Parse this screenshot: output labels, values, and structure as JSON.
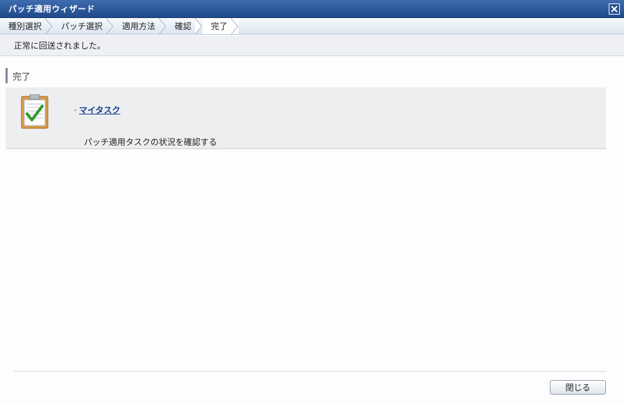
{
  "window": {
    "title": "パッチ適用ウィザード"
  },
  "steps": [
    {
      "label": "種別選択"
    },
    {
      "label": "パッチ選択"
    },
    {
      "label": "適用方法"
    },
    {
      "label": "確認"
    },
    {
      "label": "完了"
    }
  ],
  "message": "正常に回送されました。",
  "section": {
    "title": "完了"
  },
  "task": {
    "bullet": "･",
    "link_label": "マイタスク",
    "description": "パッチ適用タスクの状況を確認する"
  },
  "footer": {
    "close_label": "閉じる"
  },
  "colors": {
    "titlebar": "#2c5a9c",
    "link": "#1a3e8c",
    "panel": "#eceef0"
  }
}
